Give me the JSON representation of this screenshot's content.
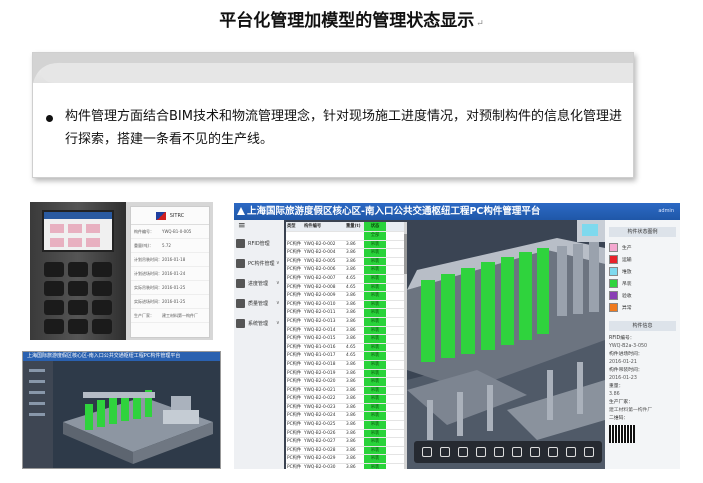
{
  "slide": {
    "title": "平台化管理加模型的管理状态显示",
    "title_mark": "↵",
    "bullet": "构件管理方面结合BIM技术和物流管理理念，针对现场施工进度情况，对预制构件的信息化管理进行探索，搭建一条看不见的生产线。"
  },
  "record_card": {
    "header": "SITRC",
    "rows": [
      {
        "k": "构件编号：",
        "v": "YWQ-B1-0-005"
      },
      {
        "k": "重量(吨)：",
        "v": "5.72"
      },
      {
        "k": "计划吊装时间：",
        "v": "2016-01-18"
      },
      {
        "k": "计划进场时间：",
        "v": "2016-01-24"
      },
      {
        "k": "实际吊装时间：",
        "v": "2016-01-25"
      },
      {
        "k": "实际进场时间：",
        "v": "2016-01-25"
      },
      {
        "k": "生产厂家：",
        "v": "建工材料第一构件厂"
      }
    ]
  },
  "thumbnail": {
    "title": "上海国际旅游度假区核心区-南入口公共交通枢纽工程PC构件管理平台"
  },
  "app": {
    "title": "上海国际旅游度假区核心区-南入口公共交通枢纽工程PC构件管理平台",
    "user": "admin",
    "menu_icon": "≡",
    "nav": [
      {
        "label": "RFID管理",
        "icon": "rss-icon"
      },
      {
        "label": "PC构件管理",
        "icon": "cube-icon"
      },
      {
        "label": "进度管理",
        "icon": "calendar-icon"
      },
      {
        "label": "质量管理",
        "icon": "search-icon"
      },
      {
        "label": "系统管理",
        "icon": "gear-icon"
      }
    ],
    "table": {
      "headers": [
        "类型",
        "构件编号",
        "重量(t)",
        "状态"
      ],
      "subheader": "全部",
      "rows": [
        [
          "PC构件",
          "YWQ-B2-0-002",
          "3.86",
          "吊装"
        ],
        [
          "PC构件",
          "YWQ-B2-0-004",
          "3.86",
          "吊装"
        ],
        [
          "PC构件",
          "YWQ-B2-0-005",
          "3.86",
          "吊装"
        ],
        [
          "PC构件",
          "YWQ-B2-0-006",
          "3.86",
          "吊装"
        ],
        [
          "PC构件",
          "YWQ-B2-0-007",
          "4.65",
          "吊装"
        ],
        [
          "PC构件",
          "YWQ-B2-0-008",
          "4.65",
          "吊装"
        ],
        [
          "PC构件",
          "YWQ-B2-0-009",
          "3.86",
          "吊装"
        ],
        [
          "PC构件",
          "YWQ-B2-0-010",
          "3.86",
          "吊装"
        ],
        [
          "PC构件",
          "YWQ-B2-0-011",
          "3.86",
          "吊装"
        ],
        [
          "PC构件",
          "YWQ-B2-0-013",
          "3.86",
          "吊装"
        ],
        [
          "PC构件",
          "YWQ-B2-0-014",
          "3.86",
          "吊装"
        ],
        [
          "PC构件",
          "YWQ-B2-0-015",
          "3.86",
          "吊装"
        ],
        [
          "PC构件",
          "YWQ-B1-0-016",
          "4.65",
          "吊装"
        ],
        [
          "PC构件",
          "YWQ-B1-0-017",
          "4.65",
          "吊装"
        ],
        [
          "PC构件",
          "YWQ-B2-0-018",
          "3.86",
          "吊装"
        ],
        [
          "PC构件",
          "YWQ-B2-0-019",
          "3.86",
          "吊装"
        ],
        [
          "PC构件",
          "YWQ-B2-0-020",
          "3.86",
          "吊装"
        ],
        [
          "PC构件",
          "YWQ-B2-0-021",
          "3.86",
          "吊装"
        ],
        [
          "PC构件",
          "YWQ-B2-0-022",
          "3.86",
          "吊装"
        ],
        [
          "PC构件",
          "YWQ-B2-0-023",
          "3.86",
          "吊装"
        ],
        [
          "PC构件",
          "YWQ-B2-0-024",
          "3.86",
          "吊装"
        ],
        [
          "PC构件",
          "YWQ-B2-0-025",
          "3.86",
          "吊装"
        ],
        [
          "PC构件",
          "YWQ-B2-0-026",
          "3.86",
          "吊装"
        ],
        [
          "PC构件",
          "YWQ-B2-0-027",
          "3.86",
          "吊装"
        ],
        [
          "PC构件",
          "YWQ-B2-0-028",
          "3.86",
          "吊装"
        ],
        [
          "PC构件",
          "YWQ-B2-0-029",
          "3.86",
          "吊装"
        ],
        [
          "PC构件",
          "YWQ-B2-0-030",
          "3.86",
          "吊装"
        ],
        [
          "PC构件",
          "YWQ-B2-0-031",
          "3.86",
          "吊装"
        ]
      ]
    },
    "legend": {
      "title": "构件状态图例",
      "items": [
        {
          "label": "生产",
          "color": "#f4a8d0"
        },
        {
          "label": "运输",
          "color": "#e8222a"
        },
        {
          "label": "堆放",
          "color": "#7fd9ee"
        },
        {
          "label": "吊装",
          "color": "#2fd33d"
        },
        {
          "label": "验收",
          "color": "#8a3fb5"
        },
        {
          "label": "异常",
          "color": "#f07a1e"
        }
      ]
    },
    "info": {
      "title": "构件信息",
      "rows": [
        {
          "k": "RFID编号：",
          "v": "YWQ-B2a-3-050"
        },
        {
          "k": "构件进场时间：",
          "v": "2016-01-21"
        },
        {
          "k": "构件吊装时间：",
          "v": "2016-01-23"
        },
        {
          "k": "重量：",
          "v": "3.86"
        },
        {
          "k": "生产厂家：",
          "v": "建工材料第一构件厂"
        }
      ],
      "qr_label": "二维码："
    },
    "colors": {
      "header": "#2263bc",
      "status_green": "#29d33a",
      "viewport": "#394352"
    }
  }
}
